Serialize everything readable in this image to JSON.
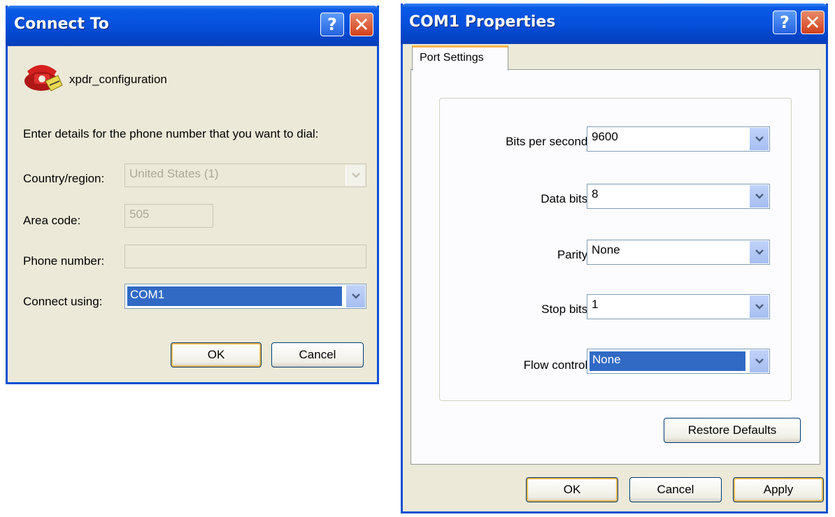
{
  "connect_dialog": {
    "title": "Connect To",
    "help_icon": "?",
    "close_icon": "✕",
    "connection_name": "xpdr_configuration",
    "instructions": "Enter details for the phone number that you want to dial:",
    "country_label": "Country/region:",
    "country_value": "United States (1)",
    "area_code_label": "Area code:",
    "area_code_value": "505",
    "phone_label": "Phone number:",
    "phone_value": "",
    "connect_using_label": "Connect using:",
    "connect_using_value": "COM1",
    "ok_label": "OK",
    "cancel_label": "Cancel"
  },
  "com_dialog": {
    "title": "COM1 Properties",
    "help_icon": "?",
    "close_icon": "✕",
    "tab_label": "Port Settings",
    "bits_label": "Bits per second:",
    "bits_value": "9600",
    "data_bits_label": "Data bits:",
    "data_bits_value": "8",
    "parity_label": "Parity:",
    "parity_value": "None",
    "stop_bits_label": "Stop bits:",
    "stop_bits_value": "1",
    "flow_label": "Flow control:",
    "flow_value": "None",
    "restore_label": "Restore Defaults",
    "ok_label": "OK",
    "cancel_label": "Cancel",
    "apply_label": "Apply"
  },
  "icons": {
    "phone": "telephone-icon",
    "dropdown": "chevron-down-icon"
  },
  "colors": {
    "titlebar": "#0550dc",
    "selection": "#316ac5",
    "dialog_bg": "#ece9d8",
    "close_button": "#d2401c",
    "default_button_glow": "#f0b84c"
  }
}
